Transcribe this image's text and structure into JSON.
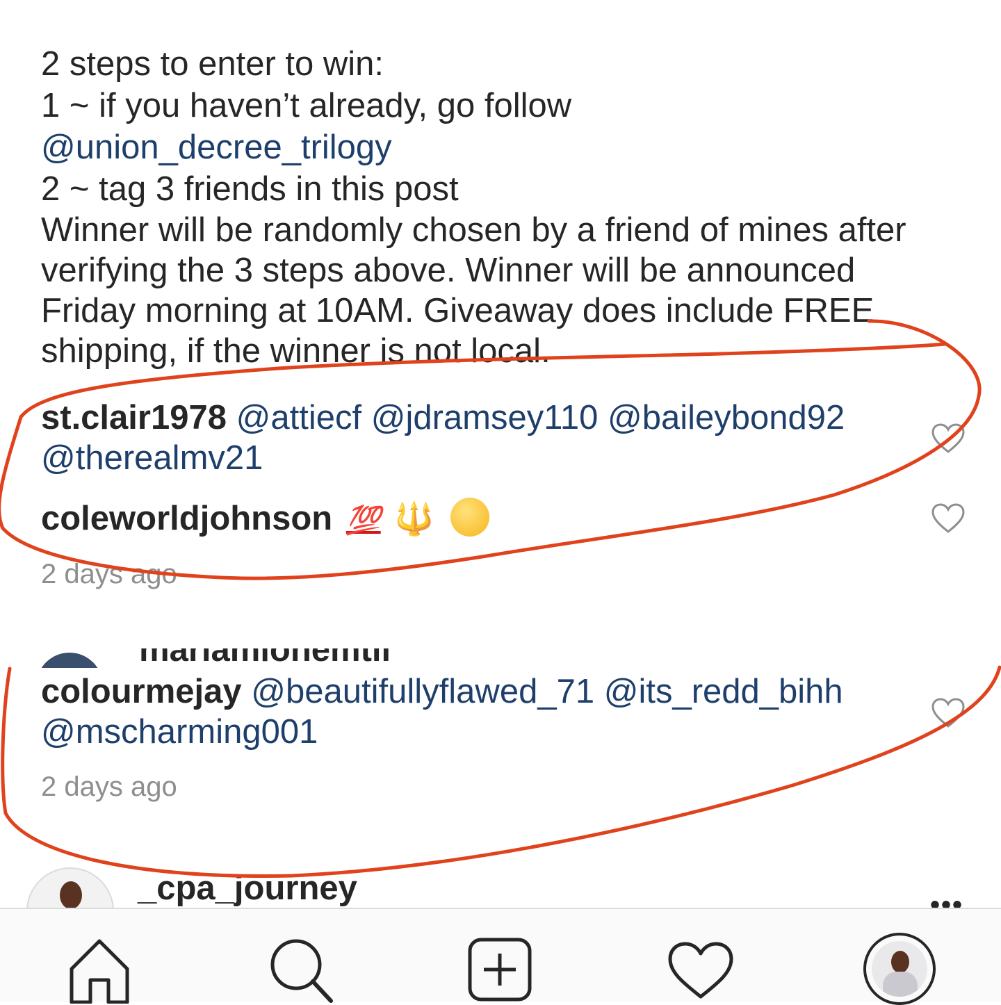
{
  "caption": {
    "line1": "2 steps to enter to win:",
    "line2": "1 ~ if you haven’t already, go follow",
    "mention": "@union_decree_trilogy",
    "line3": "2 ~ tag 3 friends in this post",
    "paragraph": "Winner will be randomly chosen by a friend of mines after verifying the 3 steps above. Winner will be announced Friday morning at 10AM. Giveaway does include FREE shipping, if the winner is not local."
  },
  "comments": [
    {
      "user": "st.clair1978",
      "mentions": [
        "@attiecf",
        "@jdramsey110",
        "@baileybond92",
        "@therealmv21"
      ]
    },
    {
      "user": "coleworldjohnson",
      "emojis": [
        "💯",
        "🔱",
        "🤤"
      ],
      "time": "2 days ago"
    }
  ],
  "peek_comment": {
    "partial_user": "mariamlonemtii"
  },
  "comment3": {
    "user": "colourmejay",
    "mentions": [
      "@beautifullyflawed_71",
      "@its_redd_bihh",
      "@mscharming001"
    ],
    "time": "2 days ago"
  },
  "next_comment": {
    "user": "_cpa_journey",
    "more": "•••"
  },
  "tabbar": {
    "icons": [
      "home-icon",
      "search-icon",
      "new-post-icon",
      "activity-heart-icon",
      "profile-avatar"
    ]
  },
  "colors": {
    "mention": "#1e3f6b",
    "text": "#262626",
    "muted": "#8e8e8e",
    "markup": "#e0421c"
  }
}
